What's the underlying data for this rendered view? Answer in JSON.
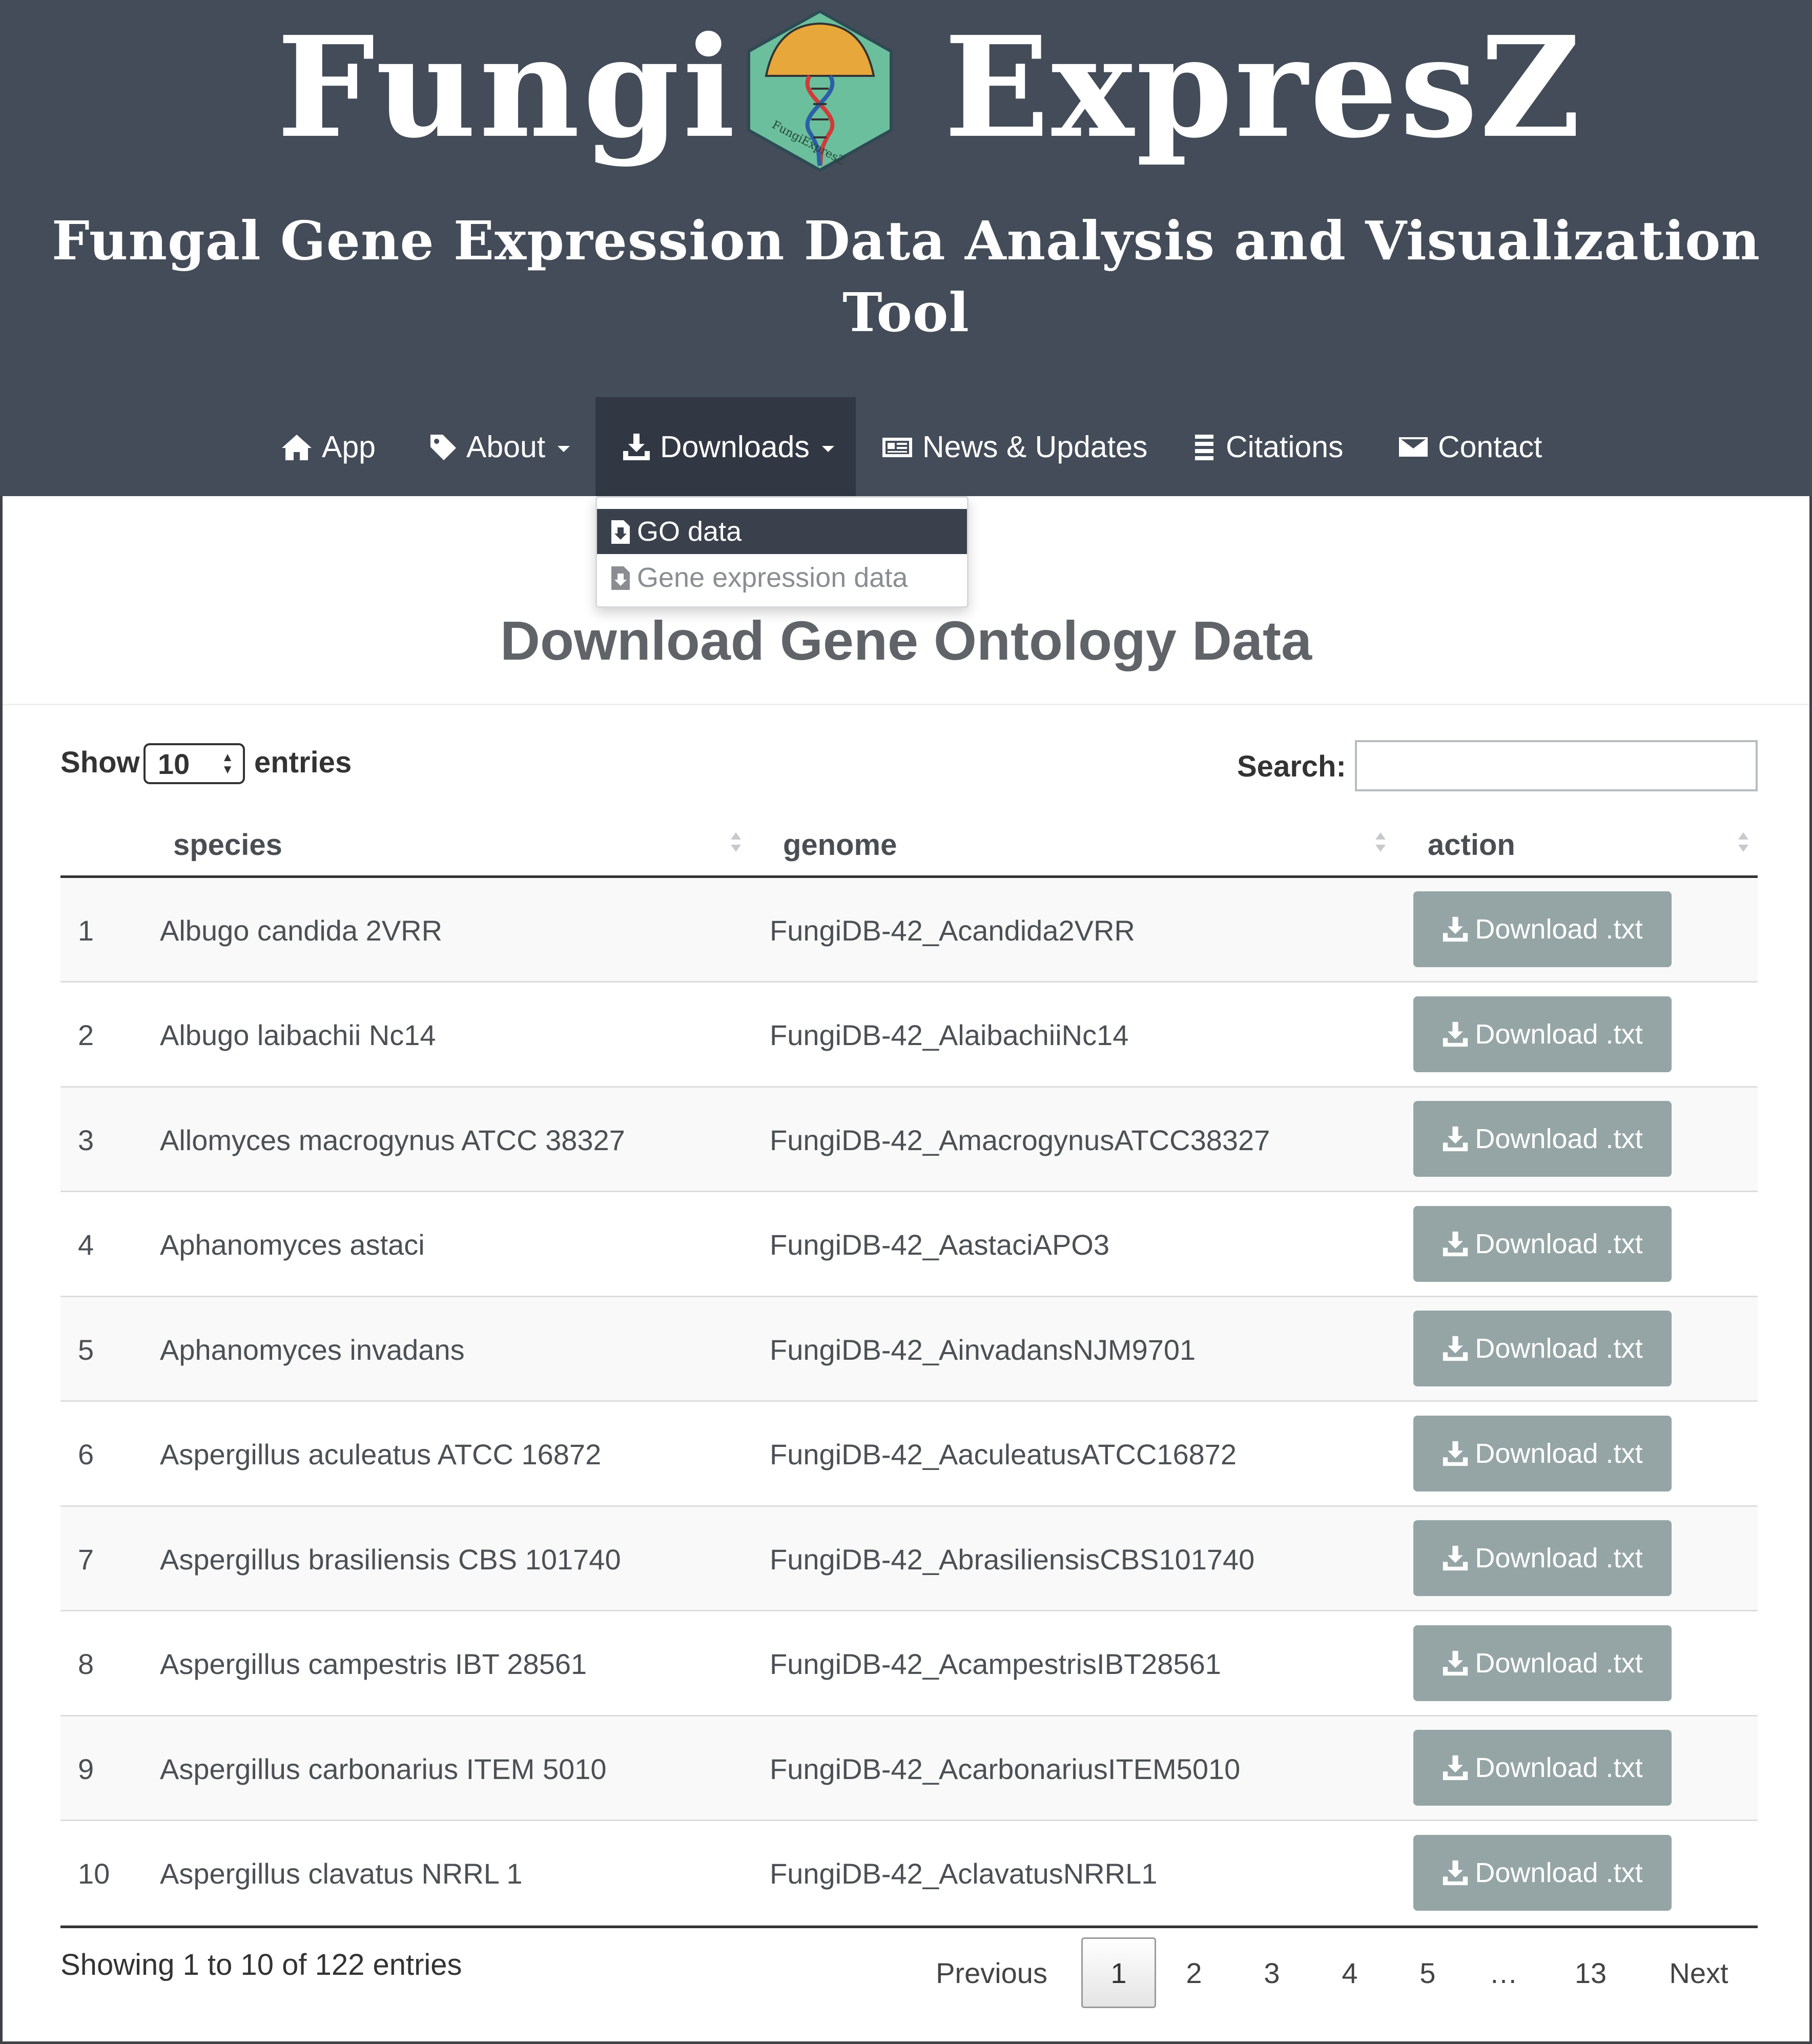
{
  "header": {
    "title_left": "Fungi",
    "title_right": "ExpresZ",
    "logo_text": "FungiExpresZ",
    "subtitle": "Fungal Gene Expression Data Analysis and Visualization Tool"
  },
  "nav": {
    "items": [
      {
        "label": "App",
        "icon": "home-icon"
      },
      {
        "label": "About",
        "icon": "tag-icon",
        "dropdown": true
      },
      {
        "label": "Downloads",
        "icon": "download-icon",
        "dropdown": true,
        "active": true
      },
      {
        "label": "News & Updates",
        "icon": "newspaper-icon"
      },
      {
        "label": "Citations",
        "icon": "list-icon"
      },
      {
        "label": "Contact",
        "icon": "envelope-icon"
      }
    ]
  },
  "dropdown": {
    "items": [
      {
        "label": "GO data",
        "icon": "file-download-icon",
        "active": true
      },
      {
        "label": "Gene expression data",
        "icon": "file-download-icon"
      }
    ]
  },
  "page": {
    "title": "Download Gene Ontology Data"
  },
  "controls": {
    "show_label": "Show",
    "entries_label": "entries",
    "page_size": "10",
    "search_label": "Search:",
    "search_value": ""
  },
  "table": {
    "headers": [
      "species",
      "genome",
      "action"
    ],
    "rows": [
      {
        "n": "1",
        "species": "Albugo candida 2VRR",
        "genome": "FungiDB-42_Acandida2VRR",
        "action": "Download .txt"
      },
      {
        "n": "2",
        "species": "Albugo laibachii Nc14",
        "genome": "FungiDB-42_AlaibachiiNc14",
        "action": "Download .txt"
      },
      {
        "n": "3",
        "species": "Allomyces macrogynus ATCC 38327",
        "genome": "FungiDB-42_AmacrogynusATCC38327",
        "action": "Download .txt"
      },
      {
        "n": "4",
        "species": "Aphanomyces astaci",
        "genome": "FungiDB-42_AastaciAPO3",
        "action": "Download .txt"
      },
      {
        "n": "5",
        "species": "Aphanomyces invadans",
        "genome": "FungiDB-42_AinvadansNJM9701",
        "action": "Download .txt"
      },
      {
        "n": "6",
        "species": "Aspergillus aculeatus ATCC 16872",
        "genome": "FungiDB-42_AaculeatusATCC16872",
        "action": "Download .txt"
      },
      {
        "n": "7",
        "species": "Aspergillus brasiliensis CBS 101740",
        "genome": "FungiDB-42_AbrasiliensisCBS101740",
        "action": "Download .txt"
      },
      {
        "n": "8",
        "species": "Aspergillus campestris IBT 28561",
        "genome": "FungiDB-42_AcampestrisIBT28561",
        "action": "Download .txt"
      },
      {
        "n": "9",
        "species": "Aspergillus carbonarius ITEM 5010",
        "genome": "FungiDB-42_AcarbonariusITEM5010",
        "action": "Download .txt"
      },
      {
        "n": "10",
        "species": "Aspergillus clavatus NRRL 1",
        "genome": "FungiDB-42_AclavatusNRRL1",
        "action": "Download .txt"
      }
    ]
  },
  "footer": {
    "info": "Showing 1 to 10 of 122 entries",
    "pagination": [
      "Previous",
      "1",
      "2",
      "3",
      "4",
      "5",
      "…",
      "13",
      "Next"
    ],
    "current_page": "1"
  },
  "colors": {
    "header_bg": "#434c58",
    "nav_active_bg": "#313843",
    "button_bg": "#95a5a6",
    "logo_bg": "#6bbf9c"
  }
}
